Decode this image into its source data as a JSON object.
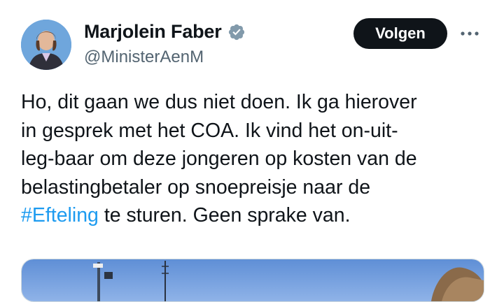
{
  "author": {
    "name": "Marjolein Faber",
    "handle": "@MinisterAenM",
    "avatar_icon": "profile-photo",
    "verified_icon": "verified-badge-icon",
    "verified_color": "#829aab"
  },
  "actions": {
    "follow_label": "Volgen",
    "more_icon": "more-horizontal-icon"
  },
  "tweet": {
    "line1": "Ho, dit gaan we dus niet doen. Ik ga hierover",
    "line2": "in gesprek met het COA. Ik vind het on-uit-",
    "line3": "leg-baar om deze jongeren op kosten van de",
    "line4": "belastingbetaler op snoepreisje naar de",
    "hashtag": "#Efteling",
    "line5_rest": " te sturen. Geen sprake van.",
    "hashtag_color": "#1d9bf0"
  },
  "media": {
    "type": "photo-preview"
  }
}
